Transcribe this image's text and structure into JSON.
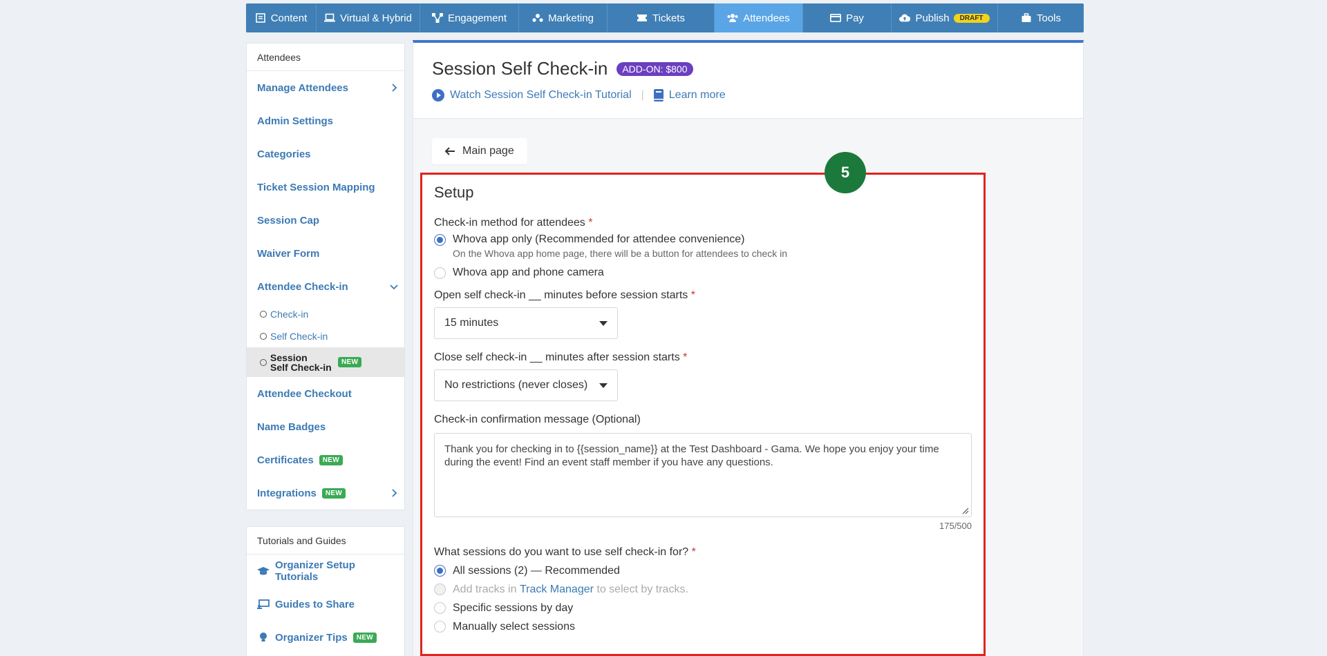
{
  "nav": {
    "tabs": [
      {
        "label": "Content",
        "icon": "document-icon"
      },
      {
        "label": "Virtual & Hybrid",
        "icon": "laptop-icon"
      },
      {
        "label": "Engagement",
        "icon": "network-icon"
      },
      {
        "label": "Marketing",
        "icon": "users-group-icon"
      },
      {
        "label": "Tickets",
        "icon": "ticket-icon"
      },
      {
        "label": "Attendees",
        "icon": "attendees-icon"
      },
      {
        "label": "Pay",
        "icon": "credit-card-icon"
      },
      {
        "label": "Publish",
        "icon": "cloud-upload-icon",
        "badge": "DRAFT"
      },
      {
        "label": "Tools",
        "icon": "toolbox-icon"
      }
    ],
    "active": "Attendees"
  },
  "sidebar": {
    "header": "Attendees",
    "items": [
      {
        "label": "Manage Attendees"
      },
      {
        "label": "Admin Settings"
      },
      {
        "label": "Categories"
      },
      {
        "label": "Ticket Session Mapping"
      },
      {
        "label": "Session Cap"
      },
      {
        "label": "Waiver Form"
      },
      {
        "label": "Attendee Check-in"
      }
    ],
    "subitems": [
      {
        "label": "Check-in"
      },
      {
        "label": "Self Check-in"
      },
      {
        "label": "Session Self Check-in",
        "line1": "Session",
        "line2": "Self Check-in",
        "badge": "NEW"
      }
    ],
    "items2": [
      {
        "label": "Attendee Checkout"
      },
      {
        "label": "Name Badges"
      },
      {
        "label": "Certificates",
        "badge": "NEW"
      },
      {
        "label": "Integrations",
        "badge": "NEW"
      }
    ]
  },
  "guides": {
    "header": "Tutorials and Guides",
    "items": [
      {
        "label": "Organizer Setup Tutorials",
        "icon": "graduation-cap-icon"
      },
      {
        "label": "Guides to Share",
        "icon": "presentation-icon"
      },
      {
        "label": "Organizer Tips",
        "icon": "lightbulb-icon",
        "badge": "NEW"
      }
    ]
  },
  "main": {
    "title": "Session Self Check-in",
    "addon": "ADD-ON: $800",
    "tutorial_link": "Watch Session Self Check-in Tutorial",
    "learn_more": "Learn more",
    "main_page_button": "Main page"
  },
  "setup": {
    "step": "5",
    "title": "Setup",
    "checkin_method_label": "Check-in method for attendees",
    "method_option1": "Whova app only (Recommended for attendee convenience)",
    "method_option1_hint": "On the Whova app home page, there will be a button for attendees to check in",
    "method_option2": "Whova app and phone camera",
    "open_label": "Open self check-in __ minutes before session starts",
    "open_value": "15 minutes",
    "close_label": "Close self check-in __ minutes after session starts",
    "close_value": "No restrictions (never closes)",
    "confirm_label": "Check-in confirmation message (Optional)",
    "confirm_text": "Thank you for checking in to {{session_name}} at the Test Dashboard - Gama. We hope you enjoy your time during the event! Find an event staff member if you have any questions.",
    "confirm_counter": "175/500",
    "sessions_label": "What sessions do you want to use self check-in for?",
    "sessions_option1": "All sessions (2) — Recommended",
    "sessions_option2_pre": "Add tracks in",
    "sessions_option2_link": "Track Manager",
    "sessions_option2_post": "to select by tracks.",
    "sessions_option3": "Specific sessions by day",
    "sessions_option4": "Manually select sessions",
    "required_mark": "*"
  },
  "colors": {
    "nav_bg": "#3f7fb5",
    "nav_active": "#5aa5e6",
    "link": "#3c7ab4",
    "addon": "#6a3fc0",
    "new_badge": "#3aaa55",
    "highlight_border": "#e0241d",
    "step_badge": "#1b7a3b"
  }
}
